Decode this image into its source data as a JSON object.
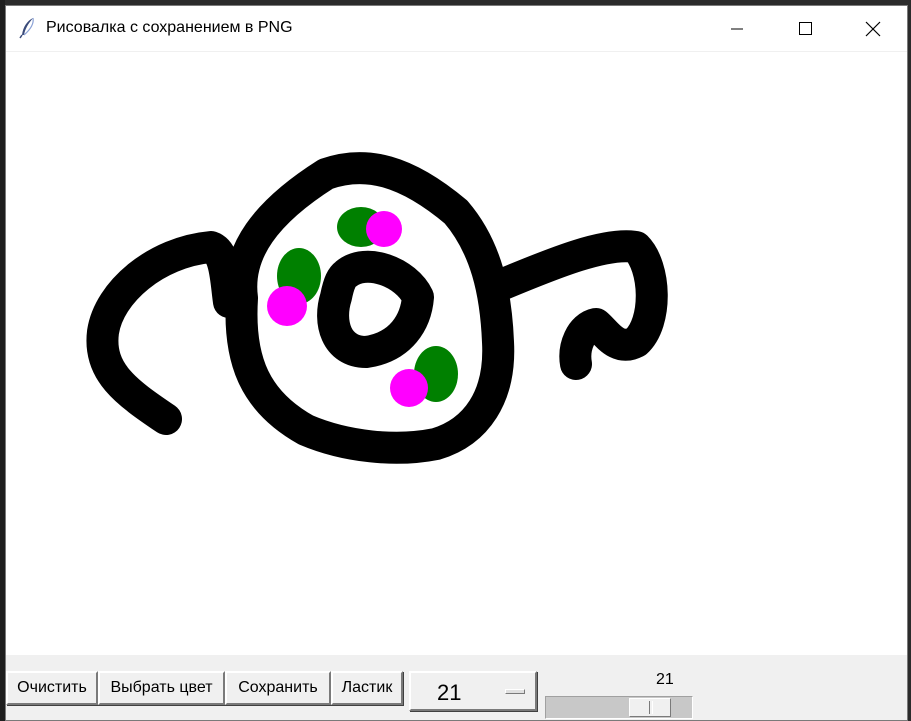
{
  "window": {
    "title": "Рисовалка с сохранением в PNG",
    "icon": "feather-icon"
  },
  "controls": {
    "minimize_icon": "minimize-icon",
    "maximize_icon": "maximize-icon",
    "close_icon": "close-icon"
  },
  "canvas": {
    "background": "#ffffff",
    "stroke_colors": [
      "#000000",
      "#008000",
      "#ff00ff"
    ]
  },
  "toolbar": {
    "clear_label": "Очистить",
    "color_label": "Выбрать цвет",
    "save_label": "Сохранить",
    "eraser_label": "Ластик",
    "brush_size_menu_value": "21",
    "brush_size_scale_value": "21",
    "brush_size_scale_level": 0.8
  }
}
